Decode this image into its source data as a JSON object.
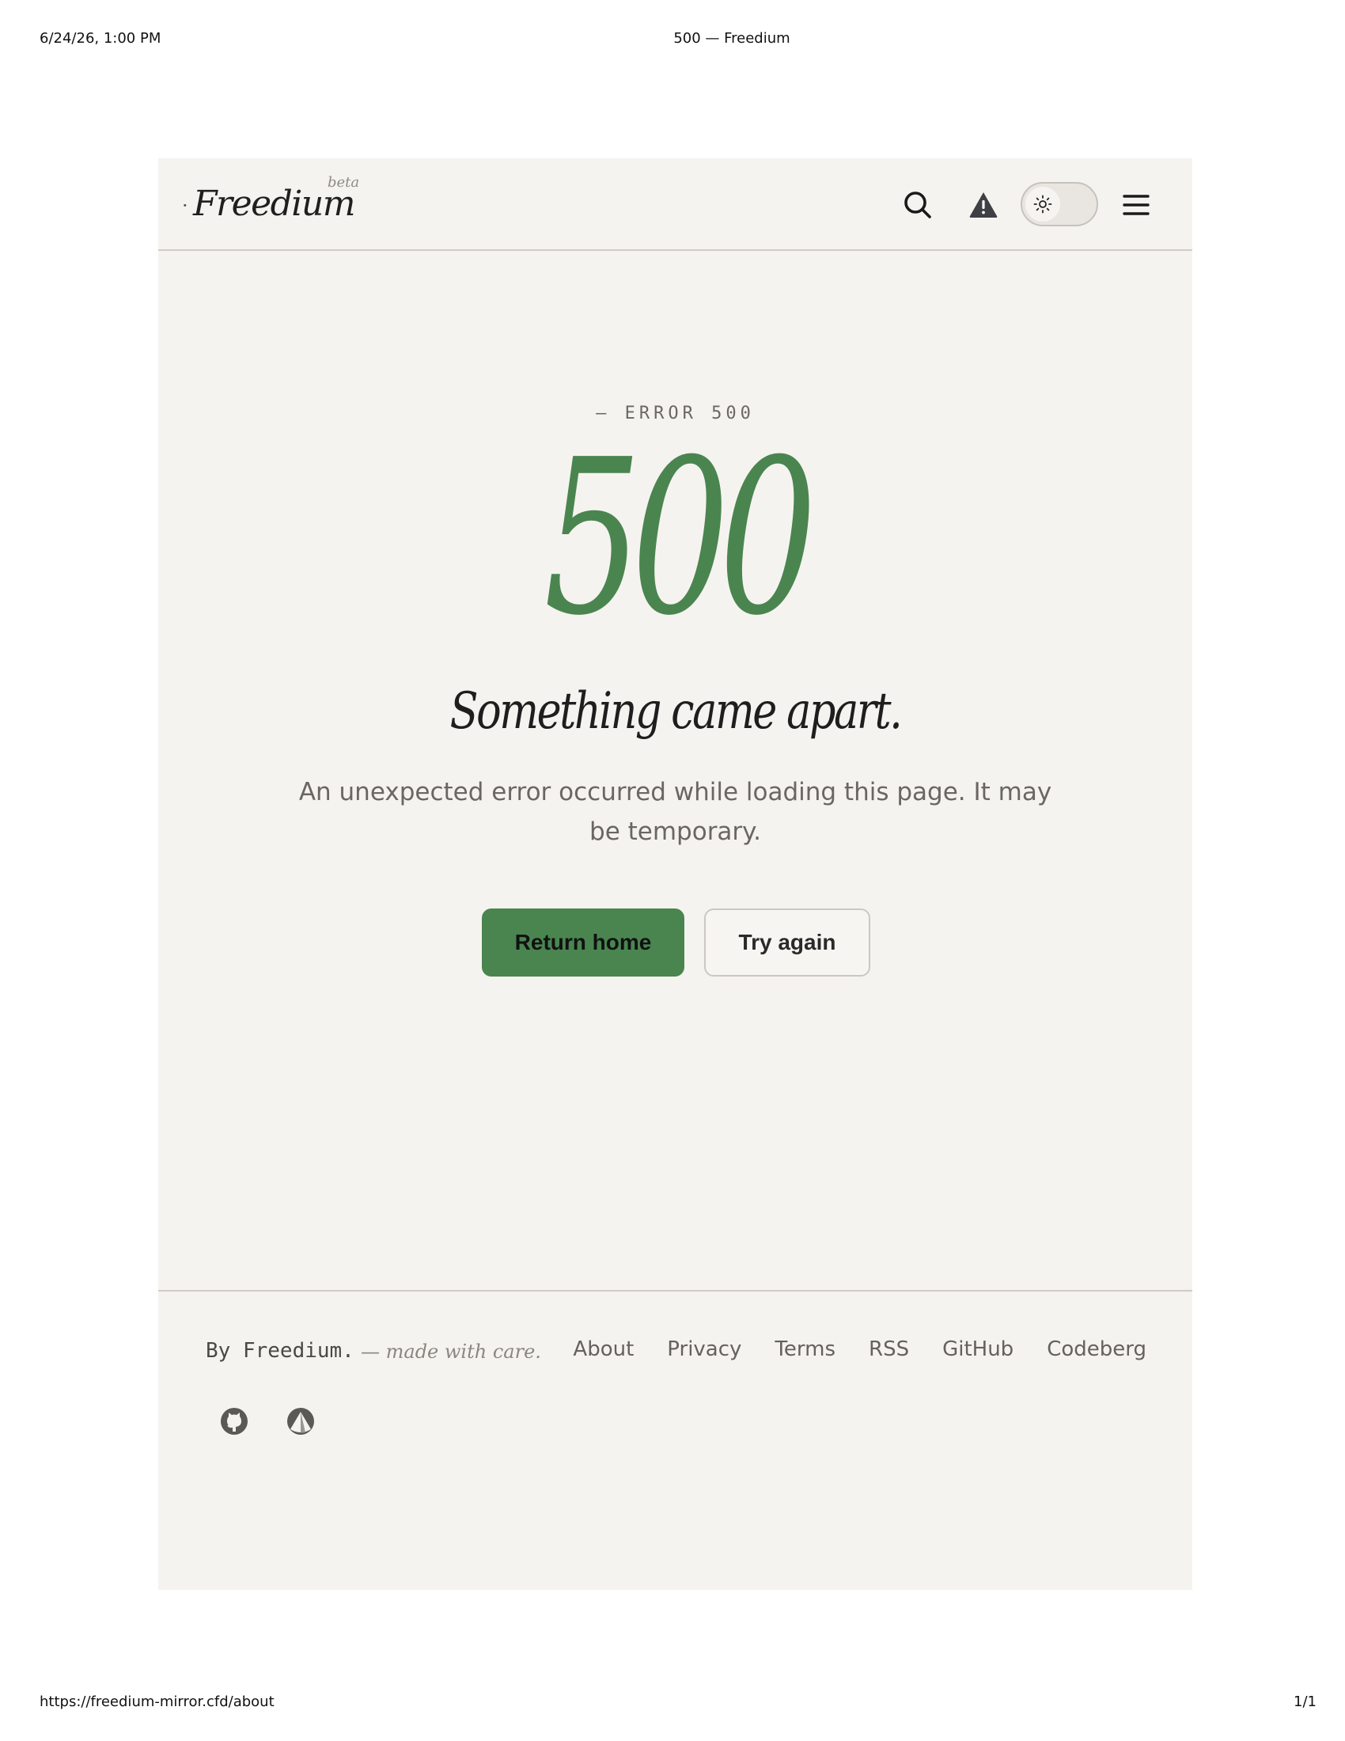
{
  "print": {
    "date": "6/24/26, 1:00 PM",
    "title": "500 — Freedium",
    "url": "https://freedium-mirror.cfd/about",
    "page": "1/1"
  },
  "header": {
    "logo": "Freedium",
    "badge": "beta",
    "icons": [
      "search-icon",
      "alert-triangle-icon",
      "sun-icon",
      "menu-icon"
    ],
    "theme": "light"
  },
  "error": {
    "kicker": "— ERROR 500",
    "code": "500",
    "headline": "Something came apart.",
    "description": "An unexpected error occurred while loading this page. It may be temporary.",
    "primary_button": "Return home",
    "secondary_button": "Try again"
  },
  "footer": {
    "byline": "By Freedium.",
    "tagline": "— made with care.",
    "links": [
      "About",
      "Privacy",
      "Terms",
      "RSS",
      "GitHub",
      "Codeberg"
    ],
    "social_icons": [
      "github-icon",
      "codeberg-icon"
    ]
  },
  "colors": {
    "accent": "#4a8550",
    "page_background": "#f5f3ef",
    "border": "#cfccc6"
  }
}
